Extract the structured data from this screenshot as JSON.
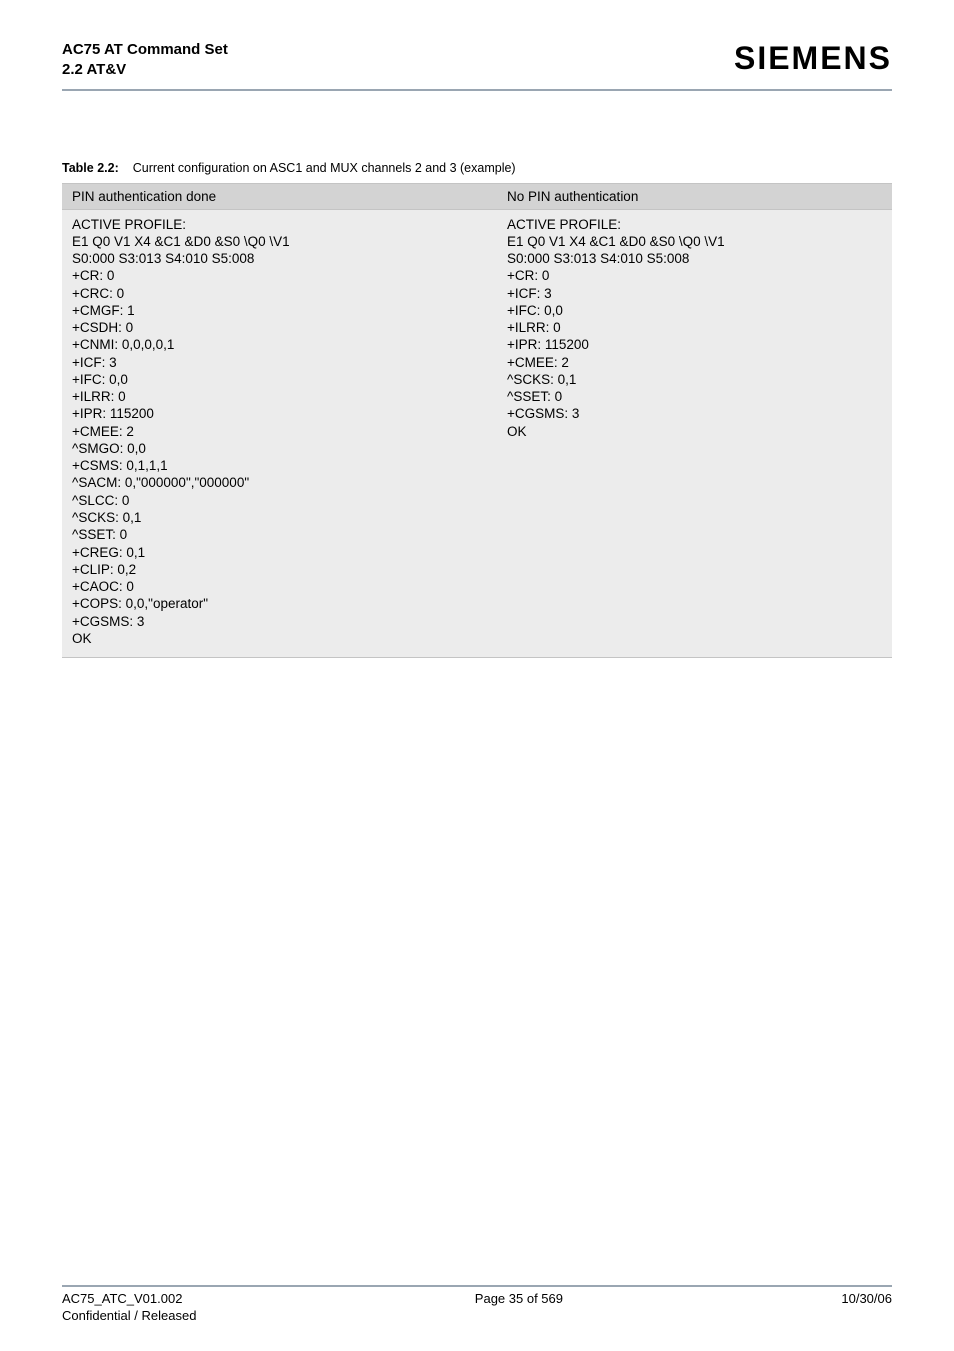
{
  "header": {
    "title_main": "AC75 AT Command Set",
    "title_sub": "2.2 AT&V",
    "brand": "SIEMENS"
  },
  "table": {
    "caption_label": "Table 2.2:",
    "caption_text": "Current configuration on ASC1 and MUX channels 2 and 3 (example)",
    "col1_header": "PIN authentication done",
    "col2_header": "No PIN authentication",
    "col1_body": "ACTIVE PROFILE:\nE1 Q0 V1 X4 &C1 &D0 &S0 \\Q0 \\V1\nS0:000 S3:013 S4:010 S5:008\n+CR: 0\n+CRC: 0\n+CMGF: 1\n+CSDH: 0\n+CNMI: 0,0,0,0,1\n+ICF: 3\n+IFC: 0,0\n+ILRR: 0\n+IPR: 115200\n+CMEE: 2\n^SMGO: 0,0\n+CSMS: 0,1,1,1\n^SACM: 0,\"000000\",\"000000\"\n^SLCC: 0\n^SCKS: 0,1\n^SSET: 0\n+CREG: 0,1\n+CLIP: 0,2\n+CAOC: 0\n+COPS: 0,0,\"operator\"\n+CGSMS: 3\nOK",
    "col2_body": "ACTIVE PROFILE:\nE1 Q0 V1 X4 &C1 &D0 &S0 \\Q0 \\V1\nS0:000 S3:013 S4:010 S5:008\n+CR: 0\n+ICF: 3\n+IFC: 0,0\n+ILRR: 0\n+IPR: 115200\n+CMEE: 2\n^SCKS: 0,1\n^SSET: 0\n+CGSMS: 3\nOK"
  },
  "footer": {
    "left_line1": "AC75_ATC_V01.002",
    "left_line2": "Confidential / Released",
    "center": "Page 35 of 569",
    "right": "10/30/06"
  }
}
